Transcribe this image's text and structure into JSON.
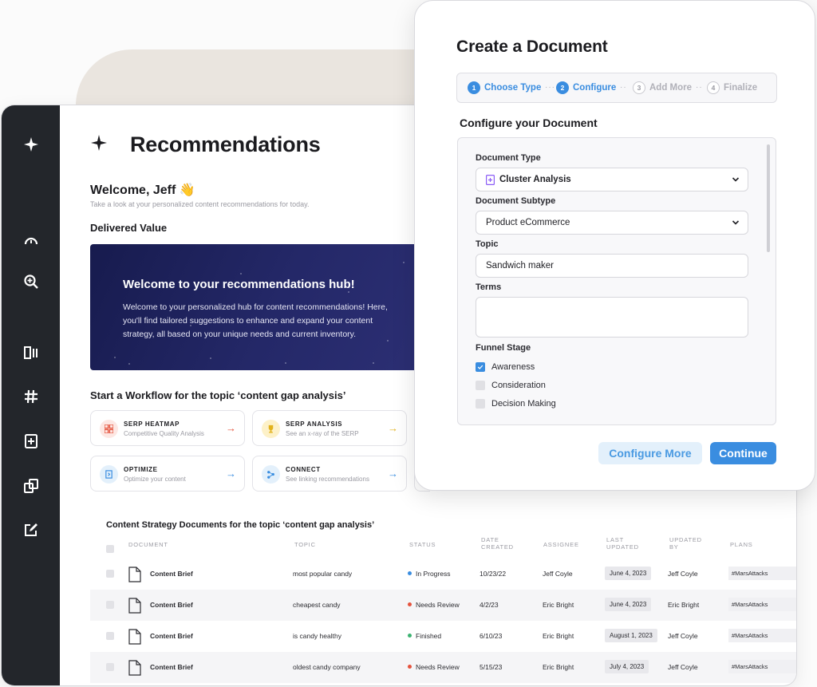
{
  "colors": {
    "accent": "#3a8de0",
    "sidebar": "#23262b",
    "hero_bg": "#1d2158"
  },
  "sidebar": {
    "items": [
      {
        "icon": "sparkle-icon"
      },
      {
        "icon": "gauge-icon"
      },
      {
        "icon": "search-zoom-icon"
      },
      {
        "icon": "columns-icon"
      },
      {
        "icon": "hashtag-icon"
      },
      {
        "icon": "document-add-icon"
      },
      {
        "icon": "copy-icon"
      },
      {
        "icon": "edit-icon"
      }
    ]
  },
  "page": {
    "title": "Recommendations",
    "welcome": "Welcome, Jeff 👋",
    "welcome_sub": "Take a look at your personalized content recommendations for today.",
    "delivered_value": "Delivered Value"
  },
  "hero": {
    "title": "Welcome to your recommendations hub!",
    "text": "Welcome to your personalized hub for content recommendations! Here, you'll find tailored suggestions to enhance and expand your content strategy, all based on your unique needs and current inventory."
  },
  "workflow": {
    "heading": "Start a Workflow for the topic ‘content gap analysis’",
    "cards": [
      {
        "title": "SERP HEATMAP",
        "subtitle": "Competitive Quality Analysis",
        "icon": "grid-icon"
      },
      {
        "title": "SERP ANALYSIS",
        "subtitle": "See an x-ray of the SERP",
        "icon": "trophy-icon"
      },
      {
        "title": "OPTIMIZE",
        "subtitle": "Optimize your content",
        "icon": "optimize-icon"
      },
      {
        "title": "CONNECT",
        "subtitle": "See linking recommendations",
        "icon": "connect-icon"
      }
    ]
  },
  "table": {
    "title": "Content Strategy Documents for the topic ‘content gap analysis’",
    "headers": [
      "DOCUMENT",
      "TOPIC",
      "STATUS",
      "DATE CREATED",
      "ASSIGNEE",
      "LAST UPDATED",
      "UPDATED BY",
      "PLANS"
    ],
    "rows": [
      {
        "document": "Content Brief",
        "topic": "most popular candy",
        "status": "In Progress",
        "status_color": "#3a8de0",
        "date_created": "10/23/22",
        "assignee": "Jeff Coyle",
        "last_updated": "June 4, 2023",
        "updated_by": "Jeff Coyle",
        "plans": "#MarsAttacks"
      },
      {
        "document": "Content Brief",
        "topic": "cheapest candy",
        "status": "Needs Review",
        "status_color": "#e5533d",
        "date_created": "4/2/23",
        "assignee": "Eric Bright",
        "last_updated": "June 4, 2023",
        "updated_by": "Eric Bright",
        "plans": "#MarsAttacks"
      },
      {
        "document": "Content Brief",
        "topic": "is candy healthy",
        "status": "Finished",
        "status_color": "#3cb371",
        "date_created": "6/10/23",
        "assignee": "Eric Bright",
        "last_updated": "August 1, 2023",
        "updated_by": "Jeff Coyle",
        "plans": "#MarsAttacks"
      },
      {
        "document": "Content Brief",
        "topic": "oldest candy company",
        "status": "Needs Review",
        "status_color": "#e5533d",
        "date_created": "5/15/23",
        "assignee": "Eric Bright",
        "last_updated": "July 4, 2023",
        "updated_by": "Jeff Coyle",
        "plans": "#MarsAttacks"
      }
    ]
  },
  "modal": {
    "title": "Create a Document",
    "steps": [
      {
        "num": "1",
        "label": "Choose Type",
        "state": "active"
      },
      {
        "num": "2",
        "label": "Configure",
        "state": "active"
      },
      {
        "num": "3",
        "label": "Add More",
        "state": "idle"
      },
      {
        "num": "4",
        "label": "Finalize",
        "state": "idle"
      }
    ],
    "section_title": "Configure your Document",
    "document_type_label": "Document Type",
    "document_type_value": "Cluster Analysis",
    "document_subtype_label": "Document Subtype",
    "document_subtype_value": "Product eCommerce",
    "topic_label": "Topic",
    "topic_value": "Sandwich maker",
    "terms_label": "Terms",
    "terms_value": "",
    "funnel_label": "Funnel Stage",
    "funnel_options": [
      {
        "label": "Awareness",
        "checked": true
      },
      {
        "label": "Consideration",
        "checked": false
      },
      {
        "label": "Decision Making",
        "checked": false
      }
    ],
    "configure_more": "Configure More",
    "continue": "Continue"
  }
}
